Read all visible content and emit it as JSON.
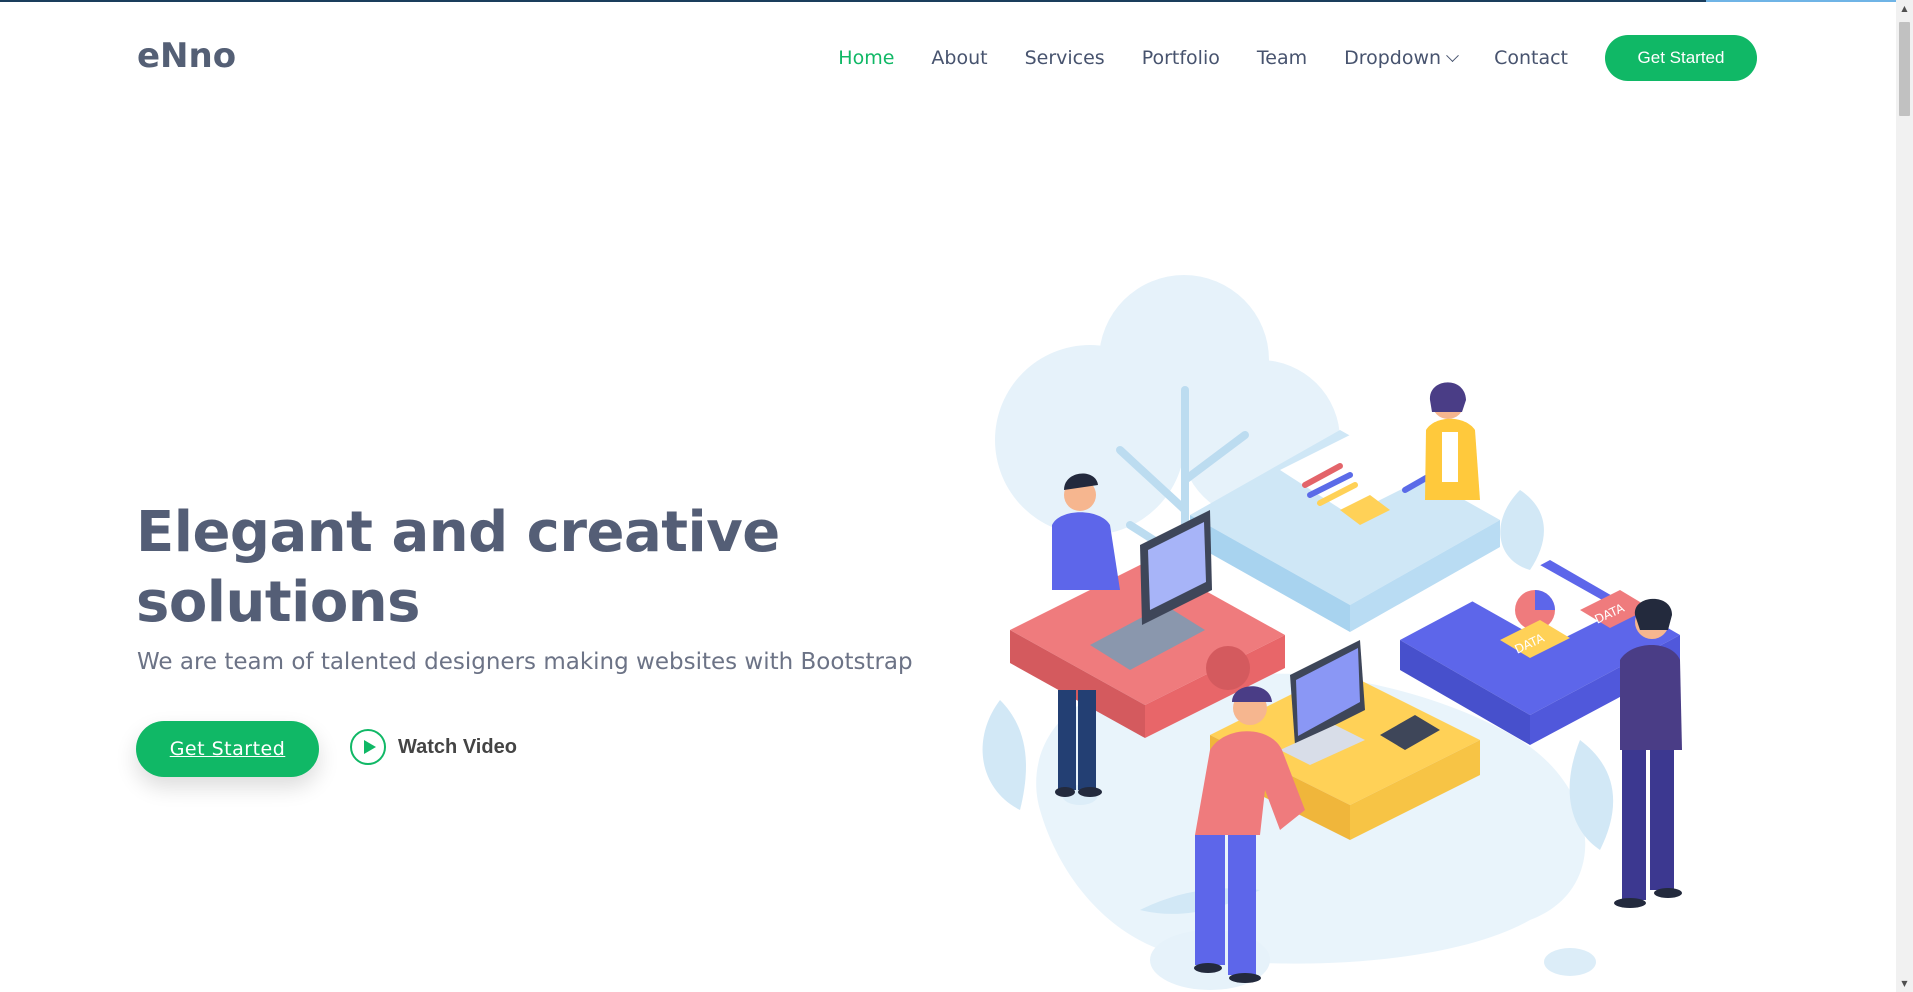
{
  "brand": {
    "name": "eNno",
    "accent": "#10b866",
    "text_color": "#545e76"
  },
  "nav": {
    "items": [
      {
        "label": "Home",
        "active": true
      },
      {
        "label": "About"
      },
      {
        "label": "Services"
      },
      {
        "label": "Portfolio"
      },
      {
        "label": "Team"
      },
      {
        "label": "Dropdown",
        "icon": "chevron-down-icon"
      },
      {
        "label": "Contact"
      }
    ],
    "cta_label": "Get Started"
  },
  "hero": {
    "title_line1": "Elegant and creative",
    "title_line2": "solutions",
    "subtitle": "We are team of talented designers making websites with Bootstrap",
    "cta_label": "Get Started",
    "video_label": "Watch Video",
    "video_icon": "play-icon",
    "illustration_labels": [
      "DATA",
      "DATA"
    ]
  },
  "scrollbar": {
    "up_icon": "scroll-up-arrow-icon",
    "down_icon": "scroll-down-arrow-icon"
  }
}
